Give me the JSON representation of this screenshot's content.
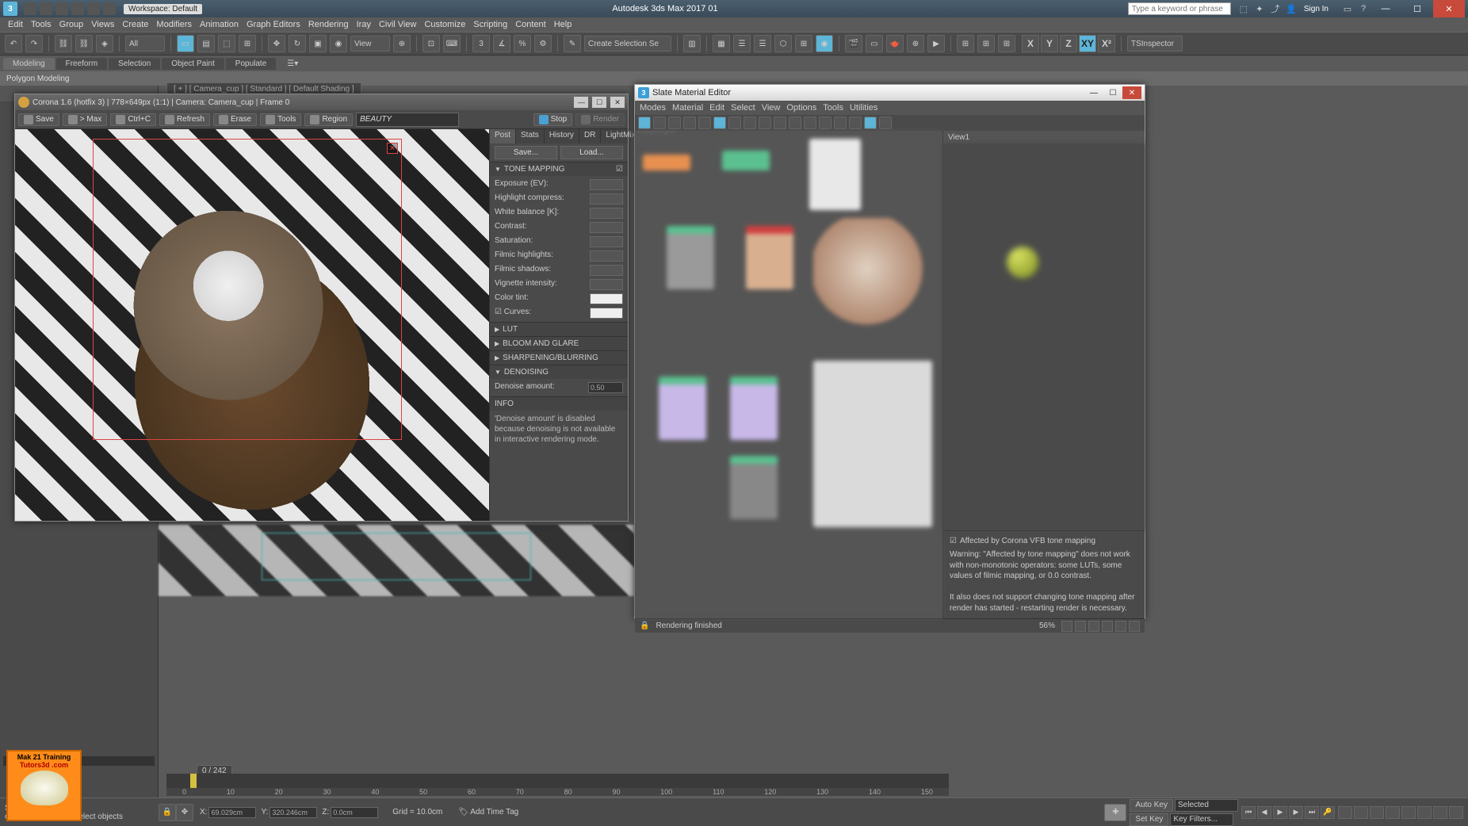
{
  "app": {
    "title": "Autodesk 3ds Max 2017    01",
    "workspace_label": "Workspace: Default",
    "search_placeholder": "Type a keyword or phrase",
    "sign_in": "Sign In"
  },
  "main_menu": [
    "Edit",
    "Tools",
    "Group",
    "Views",
    "Create",
    "Modifiers",
    "Animation",
    "Graph Editors",
    "Rendering",
    "Iray",
    "Civil View",
    "Customize",
    "Scripting",
    "Content",
    "Help"
  ],
  "toolbar": {
    "filter": "All",
    "view_dd": "View",
    "sel_dd": "Create Selection Se",
    "inspector": "TSInspector"
  },
  "axes": [
    "X",
    "Y",
    "Z",
    "XY",
    "X²"
  ],
  "ribbon_tabs": [
    "Modeling",
    "Freeform",
    "Selection",
    "Object Paint",
    "Populate"
  ],
  "sub_ribbon": "Polygon Modeling",
  "viewport_label": "[ + ] [ Camera_cup ] [ Standard ] [ Default Shading ]",
  "corona": {
    "title": "Corona 1.6 (hotfix 3) | 778×649px (1:1) | Camera: Camera_cup | Frame 0",
    "buttons": {
      "save": "Save",
      "max": "> Max",
      "ctrlc": "Ctrl+C",
      "refresh": "Refresh",
      "erase": "Erase",
      "tools": "Tools",
      "region": "Region",
      "stop": "Stop",
      "render": "Render"
    },
    "channel": "BEAUTY",
    "tabs": [
      "Post",
      "Stats",
      "History",
      "DR",
      "LightMix"
    ],
    "save_btn": "Save...",
    "load_btn": "Load...",
    "sections": {
      "tone_mapping": "TONE MAPPING",
      "lut": "LUT",
      "bloom": "BLOOM AND GLARE",
      "sharpen": "SHARPENING/BLURRING",
      "denoise": "DENOISING",
      "info": "INFO"
    },
    "params": {
      "exposure": "Exposure (EV):",
      "highlight": "Highlight compress:",
      "wb": "White balance [K]:",
      "contrast": "Contrast:",
      "saturation": "Saturation:",
      "filmic_h": "Filmic highlights:",
      "filmic_s": "Filmic shadows:",
      "vignette": "Vignette intensity:",
      "tint": "Color tint:",
      "curves": "Curves:",
      "denoise_amt": "Denoise amount:",
      "denoise_val": "0.50"
    },
    "info_text": "'Denoise amount' is disabled because denoising is not available in interactive rendering mode."
  },
  "slate": {
    "title": "Slate Material Editor",
    "menu": [
      "Modes",
      "Material",
      "Edit",
      "Select",
      "View",
      "Options",
      "Tools",
      "Utilities"
    ],
    "view_tab": "View1",
    "side_tab": "View1",
    "affected_chk": "Affected by Corona VFB tone mapping",
    "warn1": "Warning: \"Affected by tone mapping\" does not work with non-monotonic operators: some LUTs, some values of filmic mapping, or 0.0 contrast.",
    "warn2": "It also does not support changing tone mapping after render has started - restarting render is necessary.",
    "status": "Rendering finished",
    "zoom": "56%"
  },
  "timeline": {
    "frame": "0 / 242",
    "ticks": [
      "0",
      "10",
      "20",
      "30",
      "40",
      "50",
      "60",
      "70",
      "80",
      "90",
      "100",
      "110",
      "120",
      "130",
      "140",
      "150"
    ]
  },
  "status": {
    "selected": "Selected",
    "prompt": "or click-and-drag to select objects",
    "x_lbl": "X:",
    "x_val": "69.029cm",
    "y_lbl": "Y:",
    "y_val": "320.246cm",
    "z_lbl": "Z:",
    "z_val": "0.0cm",
    "grid": "Grid = 10.0cm",
    "add_time_tag": "Add Time Tag",
    "auto_key": "Auto Key",
    "set_key": "Set Key",
    "selected_dd": "Selected",
    "keyfilters": "Key Filters..."
  },
  "watermark": {
    "line1": "Mak 21 Training",
    "line2": "Tutors3d .com"
  }
}
